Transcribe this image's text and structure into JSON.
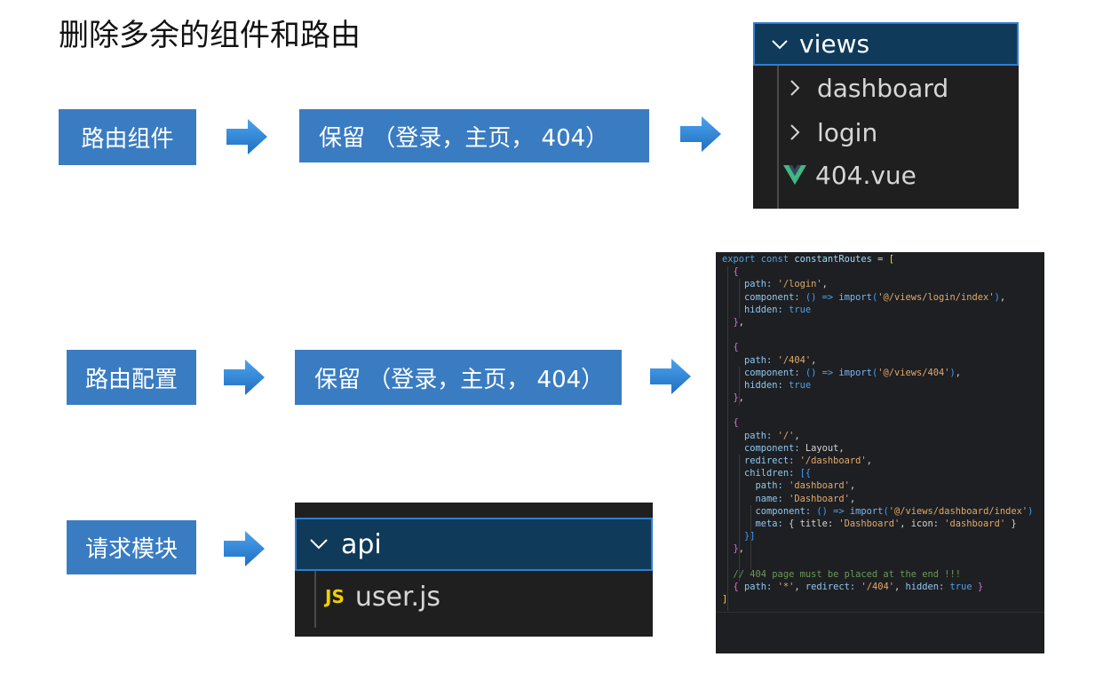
{
  "title": "删除多余的组件和路由",
  "rows": {
    "components": {
      "label": "路由组件",
      "keep": "保留 （登录，主页， 404）"
    },
    "routes": {
      "label": "路由配置",
      "keep": "保留 （登录，主页， 404）"
    },
    "api": {
      "label": "请求模块"
    }
  },
  "views_explorer": {
    "folder": "views",
    "items": [
      {
        "name": "dashboard",
        "icon": "chevron-right-icon"
      },
      {
        "name": "login",
        "icon": "chevron-right-icon"
      },
      {
        "name": "404.vue",
        "icon": "vue-icon"
      }
    ]
  },
  "api_explorer": {
    "folder": "api",
    "file_badge": "JS",
    "file": "user.js"
  },
  "colors": {
    "box_blue": "#3a7cc2",
    "arrow_blue": "#2d86d6",
    "explorer_bg": "#1f1f1f",
    "vue_green": "#41b883",
    "js_yellow": "#f0d000"
  },
  "code_lines": [
    [
      [
        "kw",
        "export const "
      ],
      [
        "ident",
        "constantRoutes"
      ],
      [
        "punc",
        " = "
      ],
      [
        "brk-y",
        "["
      ]
    ],
    [
      [
        "brk-p",
        "  {"
      ]
    ],
    [
      [
        "prop",
        "    path: "
      ],
      [
        "str",
        "'/login'"
      ],
      [
        "punc",
        ","
      ]
    ],
    [
      [
        "prop",
        "    component: "
      ],
      [
        "brk-b",
        "()"
      ],
      [
        "kw",
        " => "
      ],
      [
        "fn",
        "import"
      ],
      [
        "brk-b",
        "("
      ],
      [
        "str",
        "'@/views/login/index'"
      ],
      [
        "brk-b",
        ")"
      ],
      [
        "punc",
        ","
      ]
    ],
    [
      [
        "prop",
        "    hidden: "
      ],
      [
        "bool",
        "true"
      ]
    ],
    [
      [
        "brk-p",
        "  }"
      ],
      [
        "punc",
        ","
      ]
    ],
    [
      [
        "punc",
        ""
      ]
    ],
    [
      [
        "brk-p",
        "  {"
      ]
    ],
    [
      [
        "prop",
        "    path: "
      ],
      [
        "str",
        "'/404'"
      ],
      [
        "punc",
        ","
      ]
    ],
    [
      [
        "prop",
        "    component: "
      ],
      [
        "brk-b",
        "()"
      ],
      [
        "kw",
        " => "
      ],
      [
        "fn",
        "import"
      ],
      [
        "brk-b",
        "("
      ],
      [
        "str",
        "'@/views/404'"
      ],
      [
        "brk-b",
        ")"
      ],
      [
        "punc",
        ","
      ]
    ],
    [
      [
        "prop",
        "    hidden: "
      ],
      [
        "bool",
        "true"
      ]
    ],
    [
      [
        "brk-p",
        "  }"
      ],
      [
        "punc",
        ","
      ]
    ],
    [
      [
        "punc",
        ""
      ]
    ],
    [
      [
        "brk-p",
        "  {"
      ]
    ],
    [
      [
        "prop",
        "    path: "
      ],
      [
        "str",
        "'/'"
      ],
      [
        "punc",
        ","
      ]
    ],
    [
      [
        "prop",
        "    component: "
      ],
      [
        "punc",
        "Layout,"
      ]
    ],
    [
      [
        "prop",
        "    redirect: "
      ],
      [
        "str",
        "'/dashboard'"
      ],
      [
        "punc",
        ","
      ]
    ],
    [
      [
        "prop",
        "    children: "
      ],
      [
        "brk-b",
        "[{"
      ]
    ],
    [
      [
        "prop",
        "      path: "
      ],
      [
        "str",
        "'dashboard'"
      ],
      [
        "punc",
        ","
      ]
    ],
    [
      [
        "prop",
        "      name: "
      ],
      [
        "str",
        "'Dashboard'"
      ],
      [
        "punc",
        ","
      ]
    ],
    [
      [
        "prop",
        "      component: "
      ],
      [
        "brk-b",
        "()"
      ],
      [
        "kw",
        " => "
      ],
      [
        "fn",
        "import"
      ],
      [
        "brk-b",
        "("
      ],
      [
        "str",
        "'@/views/dashboard/index'"
      ],
      [
        "brk-b",
        ")"
      ]
    ],
    [
      [
        "prop",
        "      meta: "
      ],
      [
        "punc",
        "{ title: "
      ],
      [
        "str",
        "'Dashboard'"
      ],
      [
        "punc",
        ", icon: "
      ],
      [
        "str",
        "'dashboard'"
      ],
      [
        "punc",
        " }"
      ]
    ],
    [
      [
        "brk-b",
        "    }]"
      ]
    ],
    [
      [
        "brk-p",
        "  }"
      ],
      [
        "punc",
        ","
      ]
    ],
    [
      [
        "punc",
        ""
      ]
    ],
    [
      [
        "cmt",
        "  // 404 page must be placed at the end !!!"
      ]
    ],
    [
      [
        "brk-p",
        "  { "
      ],
      [
        "prop",
        "path: "
      ],
      [
        "str",
        "'*'"
      ],
      [
        "punc",
        ", "
      ],
      [
        "prop",
        "redirect: "
      ],
      [
        "str",
        "'/404'"
      ],
      [
        "punc",
        ", "
      ],
      [
        "prop",
        "hidden: "
      ],
      [
        "bool",
        "true"
      ],
      [
        "brk-p",
        " }"
      ]
    ],
    [
      [
        "brk-y",
        "]"
      ]
    ]
  ]
}
